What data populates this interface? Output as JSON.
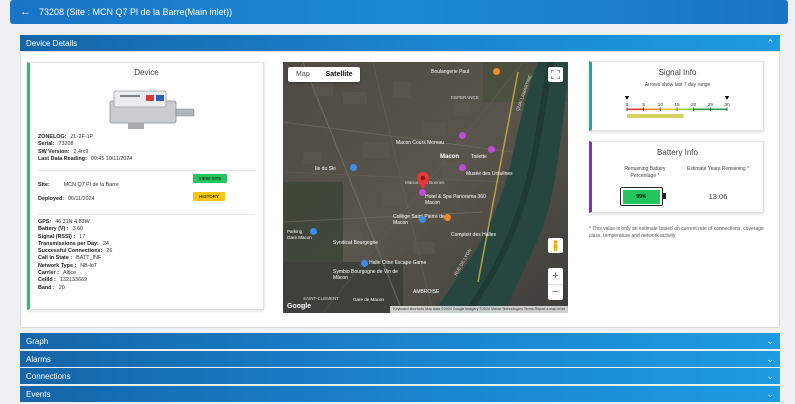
{
  "header": {
    "title": "73208 (Site : MCN Q7 Pl de la Barre(Main inlet))"
  },
  "sections": {
    "device_details": "Device Details",
    "graph": "Graph",
    "alarms": "Alarms",
    "connections": "Connections",
    "events": "Events"
  },
  "device": {
    "title": "Device",
    "zonelog_label": "ZONELOG:",
    "zonelog": "ZL-2F-1P",
    "serial_label": "Serial:",
    "serial": "73208",
    "sw_label": "SW Version:",
    "sw": "2.4rc9",
    "last_label": "Last Data Reading:",
    "last": "09:45 10/11/2024",
    "site_label": "Site:",
    "site": "MCN Q7 Pl de la Barre",
    "deployed_label": "Deployed:",
    "deployed": "06/11/2024",
    "view_site": "VIEW SITE",
    "history": "HISTORY",
    "gps_label": "GPS:",
    "gps": "46.31N 4.83W",
    "battery_label": "Battery (V) :",
    "battery": "3.60",
    "signal_label": "Signal (RSSI) :",
    "signal": "17",
    "tx_label": "Transmissions per Day:",
    "tx": "24",
    "conn_label": "Successful Connections:",
    "conn": "26",
    "callin_label": "Call In State :",
    "callin": "BATT_INF",
    "network_label": "Network Type :",
    "network": "NB-IoT",
    "carrier_label": "Carrier :",
    "carrier": "Altice",
    "cellid_label": "CellId :",
    "cellid": "132133669",
    "band_label": "Band :",
    "band": "20"
  },
  "map": {
    "tab_map": "Map",
    "tab_satellite": "Satellite",
    "labels": {
      "l1": "Boulangerie Paul",
      "l2": "ESPERANCE",
      "l3": "Macon Cours Moreau",
      "l4": "Toilette",
      "l5": "Macon",
      "l6": "Musée des Ursulines",
      "l7": "Ile du Ski",
      "l8": "Hotel & Spa Panorama 360 Macon",
      "l9": "Collège Saint-Pierre de Macon",
      "l10": "Comptoir des Halles",
      "l11": "Parking Gare Macon",
      "l12": "Halle Cline Escape Game",
      "l13": "Syndicat Bourgogne",
      "l14": "Symbio Bourgogne de Vin de Mâcon",
      "l15": "AMBROISE",
      "l16": "SAINT-CLEMENT",
      "l17": "QUAI LAMARTINE",
      "l18": "Gare de Macon",
      "l19": "Maison des Bonnes",
      "l20": "RUE DE LYON"
    },
    "google": "Google",
    "attribution": "Keyboard shortcuts  Map data ©2024 Google Imagery ©2024 Maxar Technologies  Terms  Report a map error",
    "zoom_in": "+",
    "zoom_out": "−"
  },
  "signal": {
    "title": "Signal Info",
    "subtitle": "Arrows show last 7 day range",
    "ticks": [
      "0",
      "5",
      "10",
      "15",
      "20",
      "25",
      "30"
    ],
    "range_low": 0,
    "range_high": 30,
    "current": 17
  },
  "battery_info": {
    "title": "Battery Info",
    "remaining_label": "Remaining Battery Percentage *",
    "remaining": "99%",
    "remaining_value": 99,
    "years_label": "Estimate Years Remaining *",
    "years": "13.06"
  },
  "note": "* This value is only an estimate based on current rate of connections, coverage class, temperature and network activity",
  "colors": {
    "accent": "#1a86cf",
    "green": "#22c55e",
    "teal": "#1aa5b8",
    "purple": "#8e2bb8",
    "btn_green": "#22c55e",
    "btn_yellow": "#f5c518"
  }
}
